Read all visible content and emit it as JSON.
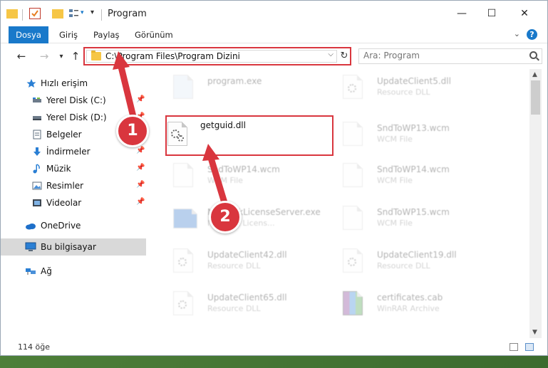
{
  "window": {
    "title": "Program",
    "controls": {
      "minimize": "—",
      "maximize": "☐",
      "close": "✕"
    }
  },
  "ribbon": {
    "tabs": [
      {
        "label": "Dosya",
        "active": true
      },
      {
        "label": "Giriş"
      },
      {
        "label": "Paylaş"
      },
      {
        "label": "Görünüm"
      }
    ],
    "help": "?"
  },
  "nav": {
    "back": "←",
    "forward": "→",
    "recent": "▾",
    "up": "↑",
    "address": "C:\\Program Files\\Program Dizini",
    "address_dropdown": "⌵",
    "refresh": "↻",
    "search_placeholder": "Ara: Program"
  },
  "sidebar": {
    "items": [
      {
        "label": "Hızlı erişim",
        "icon": "star-icon",
        "pinned": false
      },
      {
        "label": "Yerel Disk (C:)",
        "icon": "drive-icon",
        "pinned": true
      },
      {
        "label": "Yerel Disk (D:)",
        "icon": "drive-icon",
        "pinned": true
      },
      {
        "label": "Belgeler",
        "icon": "document-icon",
        "pinned": true
      },
      {
        "label": "İndirmeler",
        "icon": "download-icon",
        "pinned": true
      },
      {
        "label": "Müzik",
        "icon": "music-icon",
        "pinned": true
      },
      {
        "label": "Resimler",
        "icon": "pictures-icon",
        "pinned": true
      },
      {
        "label": "Videolar",
        "icon": "video-icon",
        "pinned": true
      },
      {
        "label": "OneDrive",
        "icon": "cloud-icon",
        "pinned": false
      },
      {
        "label": "Bu bilgisayar",
        "icon": "computer-icon",
        "pinned": false,
        "selected": true
      },
      {
        "label": "Ağ",
        "icon": "network-icon",
        "pinned": false
      }
    ]
  },
  "files": [
    {
      "name": "program.exe",
      "type": ""
    },
    {
      "name": "UpdateClient5.dll",
      "type": "Resource DLL"
    },
    {
      "name": "getguid.dll",
      "type": "",
      "highlighted": true
    },
    {
      "name": "SndToWP13.wcm",
      "type": "WCM File"
    },
    {
      "name": "SndToWP14.wcm",
      "type": "WCM File"
    },
    {
      "name": "SndToWP14.wcm",
      "type": "WCM File"
    },
    {
      "name": "NetworkLicenseServer.exe",
      "type": "Network Licens..."
    },
    {
      "name": "SndToWP15.wcm",
      "type": "WCM File"
    },
    {
      "name": "UpdateClient42.dll",
      "type": "Resource DLL"
    },
    {
      "name": "UpdateClient19.dll",
      "type": "Resource DLL"
    },
    {
      "name": "UpdateClient65.dll",
      "type": "Resource DLL"
    },
    {
      "name": "certificates.cab",
      "type": "WinRAR Archive"
    }
  ],
  "status": {
    "count": "114 öğe"
  },
  "annotations": [
    {
      "number": "1",
      "color": "#d9363e"
    },
    {
      "number": "2",
      "color": "#d9363e"
    }
  ],
  "colors": {
    "accent": "#1979ca",
    "annotation": "#d9363e",
    "folder": "#f6c646"
  }
}
